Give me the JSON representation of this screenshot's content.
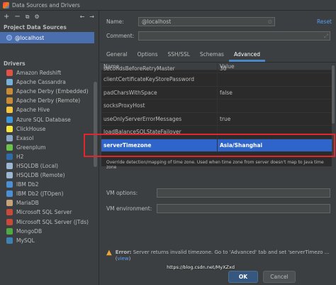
{
  "window": {
    "title": "Data Sources and Drivers"
  },
  "toolbar": {
    "add": "+",
    "remove": "−",
    "copy": "⧉",
    "settings": "⚙",
    "back": "←",
    "forward": "→"
  },
  "project_sources": {
    "heading": "Project Data Sources",
    "items": [
      {
        "label": "@localhost"
      }
    ]
  },
  "drivers": {
    "heading": "Drivers",
    "items": [
      {
        "label": "Amazon Redshift",
        "color": "#e05243"
      },
      {
        "label": "Apache Cassandra",
        "color": "#7ab0d8"
      },
      {
        "label": "Apache Derby (Embedded)",
        "color": "#c98c34"
      },
      {
        "label": "Apache Derby (Remote)",
        "color": "#c98c34"
      },
      {
        "label": "Apache Hive",
        "color": "#f5c542"
      },
      {
        "label": "Azure SQL Database",
        "color": "#3a96dd"
      },
      {
        "label": "ClickHouse",
        "color": "#f7e33d"
      },
      {
        "label": "Exasol",
        "color": "#8aa8c6"
      },
      {
        "label": "Greenplum",
        "color": "#6cc24a"
      },
      {
        "label": "H2",
        "color": "#2d6ba9"
      },
      {
        "label": "HSQLDB (Local)",
        "color": "#9bb7d3"
      },
      {
        "label": "HSQLDB (Remote)",
        "color": "#9bb7d3"
      },
      {
        "label": "IBM Db2",
        "color": "#4b8fd6"
      },
      {
        "label": "IBM Db2 (JTOpen)",
        "color": "#4b8fd6"
      },
      {
        "label": "MariaDB",
        "color": "#c8a37a"
      },
      {
        "label": "Microsoft SQL Server",
        "color": "#c94a3b"
      },
      {
        "label": "Microsoft SQL Server (jTds)",
        "color": "#c94a3b"
      },
      {
        "label": "MongoDB",
        "color": "#4faa41"
      },
      {
        "label": "MySQL",
        "color": "#3e82b4"
      }
    ]
  },
  "form": {
    "name_label": "Name:",
    "name_value": "@localhost",
    "comment_label": "Comment:",
    "comment_value": "",
    "reset_label": "Reset"
  },
  "tabs": [
    {
      "label": "General"
    },
    {
      "label": "Options"
    },
    {
      "label": "SSH/SSL"
    },
    {
      "label": "Schemas"
    },
    {
      "label": "Advanced",
      "active": true
    }
  ],
  "table": {
    "headers": {
      "name": "Name",
      "value": "Value"
    },
    "rows": [
      {
        "name": "secondsBeforeRetryMaster",
        "value": "30",
        "partial": true
      },
      {
        "name": "clientCertificateKeyStorePassword",
        "value": ""
      },
      {
        "name": "padCharsWithSpace",
        "value": "false"
      },
      {
        "name": "socksProxyHost",
        "value": ""
      },
      {
        "name": "useOnlyServerErrorMessages",
        "value": "true"
      },
      {
        "name": "loadBalanceSQLStateFailover",
        "value": ""
      },
      {
        "name": "serverTimezone",
        "value": "Asia/Shanghai",
        "selected": true
      }
    ]
  },
  "description": "Override detection/mapping of time zone. Used when time zone from server doesn't map to Java time zone",
  "vm": {
    "options_label": "VM options:",
    "options_value": "",
    "env_label": "VM environment:",
    "env_value": ""
  },
  "error": {
    "label": "Error:",
    "message": "Server returns invalid timezone. Go to 'Advanced' tab and set 'serverTimezo ...",
    "link_text": "view",
    "close": ")"
  },
  "buttons": {
    "ok": "OK",
    "cancel": "Cancel"
  },
  "watermark": "https://blog.csdn.net/MyXZxd",
  "colors": {
    "accent": "#4b6eaf",
    "selection": "#2f65ca",
    "highlight_box": "#e2262d",
    "link": "#589df6"
  }
}
